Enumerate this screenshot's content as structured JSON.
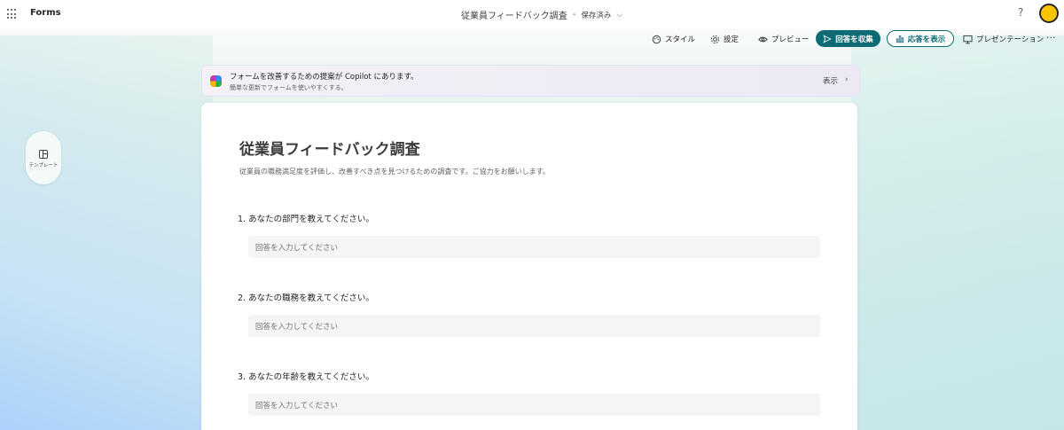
{
  "header": {
    "app_name": "Forms",
    "doc_title": "従業員フィードバック調査",
    "separator": "-",
    "save_status": "保存済み",
    "help": "?"
  },
  "toolbar": {
    "style_label": "スタイル",
    "settings_label": "設定",
    "preview_label": "プレビュー",
    "collect_label": "回答を収集",
    "show_responses_label": "応答を表示",
    "presentation_label": "プレゼンテーション",
    "more": "···"
  },
  "copilot": {
    "message": "フォームを改善するための提案が Copilot にあります。",
    "sub_message": "簡単な更新でフォームを使いやすくする。",
    "show_label": "表示"
  },
  "sidebar": {
    "template_label": "テンプレート"
  },
  "form": {
    "title": "従業員フィードバック調査",
    "description": "従業員の職務満足度を評価し、改善すべき点を見つけるための調査です。ご協力をお願いします。",
    "questions": [
      {
        "label": "1. あなたの部門を教えてください。",
        "placeholder": "回答を入力してください"
      },
      {
        "label": "2. あなたの職務を教えてください。",
        "placeholder": "回答を入力してください"
      },
      {
        "label": "3. あなたの年齢を教えてください。",
        "placeholder": "回答を入力してください"
      }
    ]
  },
  "colors": {
    "accent": "#0e6a74",
    "avatar": "#f8c400"
  },
  "icons": {
    "waffle": "app-launcher-icon",
    "style": "palette-icon",
    "settings": "gear-icon",
    "preview": "eye-icon",
    "collect": "send-icon",
    "show": "bar-chart-icon",
    "present": "monitor-icon",
    "copilot": "copilot-icon",
    "template": "template-icon"
  }
}
